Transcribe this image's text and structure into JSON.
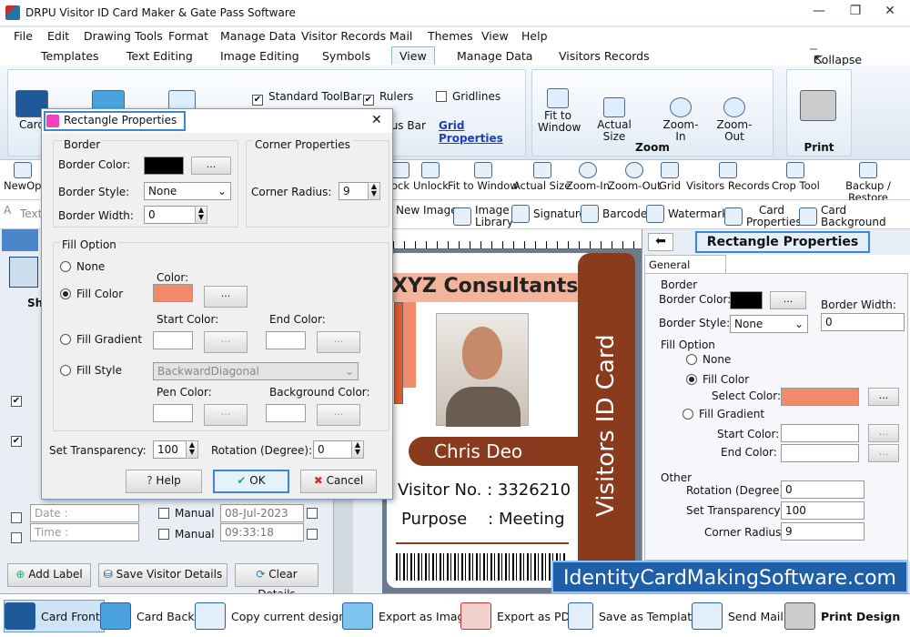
{
  "window": {
    "title": "DRPU Visitor ID Card Maker & Gate Pass Software",
    "min": "—",
    "max": "❐",
    "close": "✕"
  },
  "menu": [
    "File",
    "Edit",
    "Drawing Tools",
    "Format",
    "Manage Data",
    "Visitor Records",
    "Mail",
    "Themes",
    "View",
    "Help"
  ],
  "tabs": [
    "Templates",
    "Text Editing",
    "Image Editing",
    "Symbols",
    "View",
    "Manage Data",
    "Visitors Records"
  ],
  "collapse": "Collapse",
  "ribbon": {
    "card_label": "Card",
    "checks": {
      "standard_toolbar": "Standard ToolBar",
      "rulers": "Rulers",
      "gridlines": "Gridlines",
      "status_bar": "tus Bar",
      "grid_properties": "Grid Properties"
    },
    "zoom": {
      "fit": "Fit to Window",
      "actual": "Actual Size",
      "zoom_in": "Zoom-In",
      "zoom_out": "Zoom-Out",
      "label": "Zoom"
    },
    "print": "Print"
  },
  "toolbar2": [
    "New",
    "Op",
    "ock",
    "Unlock",
    "Fit to Window",
    "Actual Size",
    "Zoom-In",
    "Zoom-Out",
    "Grid",
    "Visitors Records",
    "Crop Tool",
    "Backup / Restore"
  ],
  "toolbar3": {
    "text": "Text",
    "new_image": "New Image",
    "image_library": "Image Library",
    "signature": "Signature",
    "barcode": "Barcode",
    "watermark": "Watermark",
    "card_properties": "Card Properties",
    "card_background": "Card Background"
  },
  "leftpanel": {
    "sh": "Sh",
    "date": "Date :",
    "time": "Time :",
    "manual": "Manual",
    "date_value": "08-Jul-2023",
    "time_value": "09:33:18",
    "add_label": "Add Label",
    "save_details": "Save Visitor Details",
    "clear_details": "Clear Details"
  },
  "card": {
    "company": "XYZ Consultants",
    "name": "Chris Deo",
    "vertical": "Visitors ID Card",
    "visitor_no_label": "Visitor No. :",
    "visitor_no": "3326210",
    "purpose_label": "Purpose    :",
    "purpose": "Meeting"
  },
  "rightpanel": {
    "title": "Rectangle Properties",
    "tab": "General Settings",
    "border": "Border",
    "border_color": "Border Color:",
    "border_width": "Border Width:",
    "border_width_val": "0",
    "border_style": "Border Style:",
    "border_style_val": "None",
    "fill_option": "Fill Option",
    "none": "None",
    "fill_color": "Fill Color",
    "select_color": "Select Color:",
    "fill_gradient": "Fill Gradient",
    "start_color": "Start Color:",
    "end_color": "End Color:",
    "other": "Other",
    "rotation": "Rotation (Degree):",
    "rotation_val": "0",
    "transparency": "Set Transparency:",
    "transparency_val": "100",
    "corner": "Corner Radius:",
    "corner_val": "9",
    "dots": "..."
  },
  "dialog": {
    "title": "Rectangle Properties",
    "close": "✕",
    "border": "Border",
    "border_color": "Border Color:",
    "border_style": "Border Style:",
    "border_style_val": "None",
    "border_width": "Border Width:",
    "border_width_val": "0",
    "corner_props": "Corner Properties",
    "corner_radius": "Corner Radius:",
    "corner_radius_val": "9",
    "fill_option": "Fill Option",
    "none": "None",
    "fill_color": "Fill Color",
    "color": "Color:",
    "start_color": "Start Color:",
    "end_color": "End Color:",
    "fill_gradient": "Fill Gradient",
    "fill_style": "Fill Style",
    "fill_style_val": "BackwardDiagonal",
    "pen_color": "Pen Color:",
    "bg_color": "Background Color:",
    "transparency": "Set Transparency:",
    "transparency_val": "100",
    "rotation": "Rotation (Degree):",
    "rotation_val": "0",
    "help": "Help",
    "ok": "OK",
    "cancel": "Cancel",
    "dots": "..."
  },
  "bottombar": [
    "Card Front",
    "Card Back",
    "Copy current design",
    "Export as Image",
    "Export as PDF",
    "Save as Template",
    "Send Mail",
    "Print Design"
  ],
  "brand": "IdentityCardMakingSoftware.com",
  "colors": {
    "accent": "#f08a6a",
    "card_brown": "#8a3a1d",
    "brand_blue": "#1f5fa8"
  }
}
